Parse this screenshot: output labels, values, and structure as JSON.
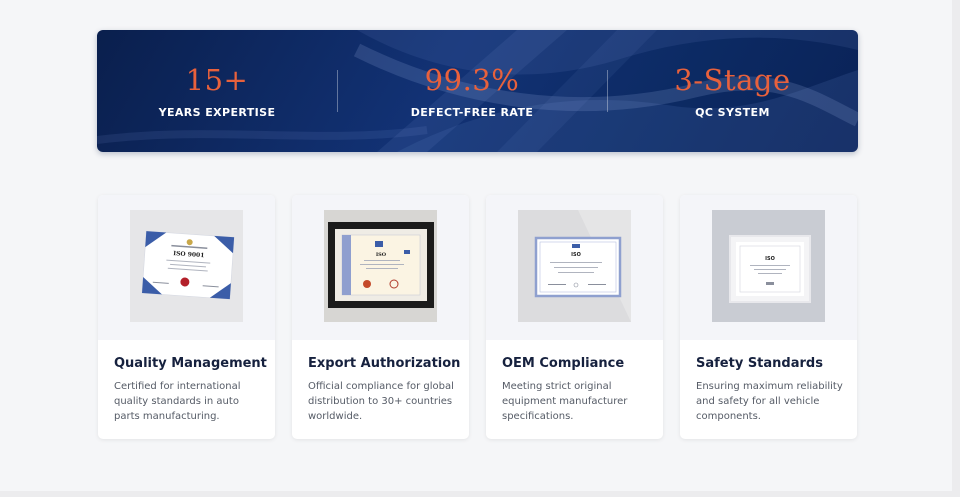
{
  "stats": [
    {
      "value": "15+",
      "label": "YEARS EXPERTISE"
    },
    {
      "value": "99.3%",
      "label": "DEFECT-FREE RATE"
    },
    {
      "value": "3-Stage",
      "label": "QC SYSTEM"
    }
  ],
  "cards": [
    {
      "title": "Quality Management",
      "desc": "Certified for international quality standards in auto parts manufacturing.",
      "certificate_text": "ISO 9001"
    },
    {
      "title": "Export Authorization",
      "desc": "Official compliance for global distribution to 30+ countries worldwide.",
      "certificate_text": "ISO"
    },
    {
      "title": "OEM Compliance",
      "desc": "Meeting strict original equipment manufacturer specifications.",
      "certificate_text": "ISO"
    },
    {
      "title": "Safety Standards",
      "desc": "Ensuring maximum reliability and safety for all vehicle components.",
      "certificate_text": "ISO"
    }
  ],
  "colors": {
    "banner": "#0c2a63",
    "accent": "#e8613c",
    "title": "#16213e"
  }
}
